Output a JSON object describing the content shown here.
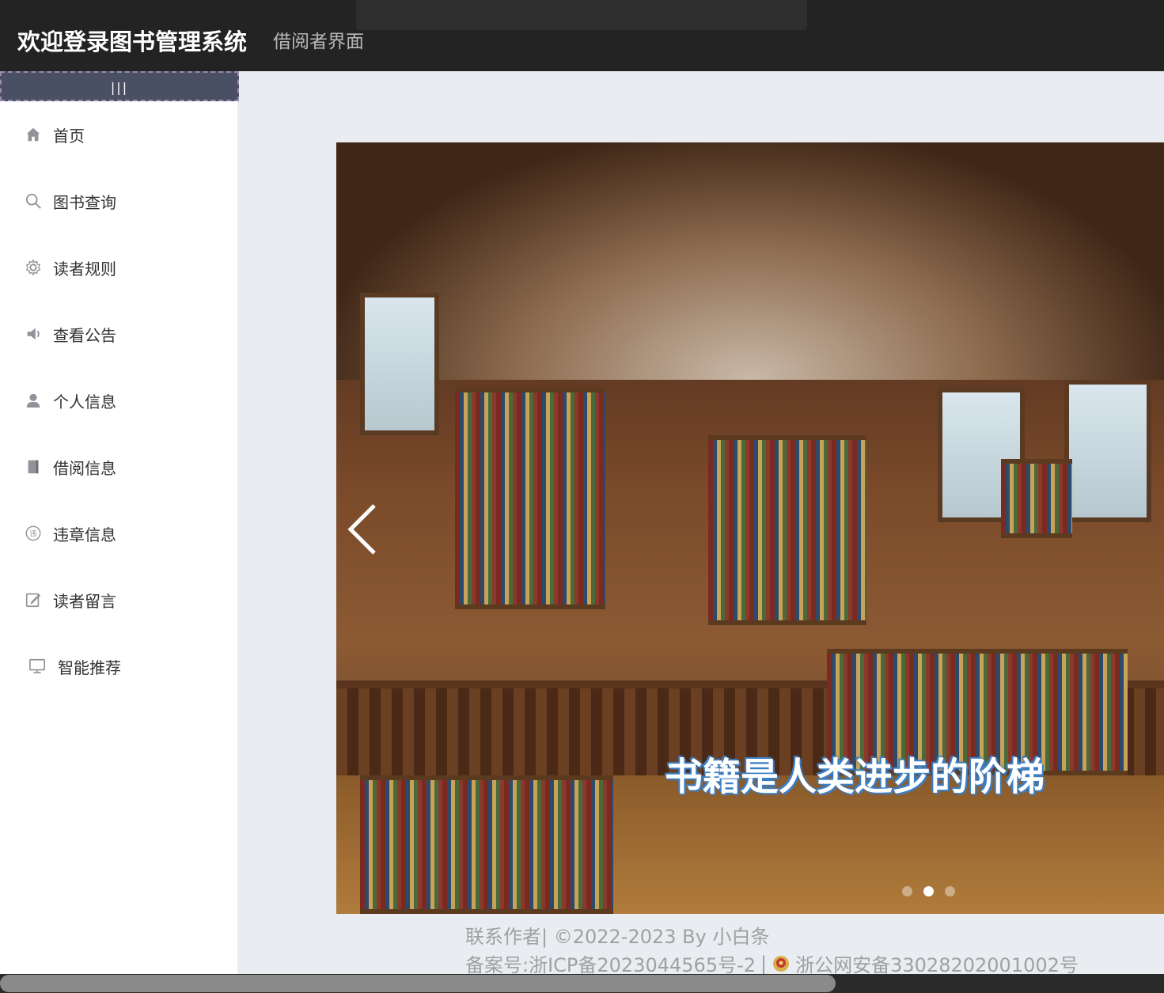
{
  "header": {
    "title": "欢迎登录图书管理系统",
    "subtitle": "借阅者界面"
  },
  "sidebar": {
    "collapse_label": "|||",
    "items": [
      {
        "icon": "home-icon",
        "label": "首页"
      },
      {
        "icon": "search-icon",
        "label": "图书查询"
      },
      {
        "icon": "settings-icon",
        "label": "读者规则"
      },
      {
        "icon": "speaker-icon",
        "label": "查看公告"
      },
      {
        "icon": "user-icon",
        "label": "个人信息"
      },
      {
        "icon": "book-icon",
        "label": "借阅信息"
      },
      {
        "icon": "violation-icon",
        "label": "违章信息"
      },
      {
        "icon": "edit-icon",
        "label": "读者留言"
      },
      {
        "icon": "monitor-icon",
        "label": "智能推荐"
      }
    ],
    "violation_icon_char": "违"
  },
  "carousel": {
    "caption": "书籍是人类进步的阶梯",
    "slide_count": 3,
    "active_index": 1
  },
  "footer": {
    "line1": "联系作者| ©2022-2023 By 小白条",
    "icp": "备案号:浙ICP备2023044565号-2",
    "separator": "|",
    "police": "浙公网安备33028202001002号"
  },
  "colors": {
    "header_bg": "#232323",
    "sidebar_toggle_bg": "#4a5064",
    "content_bg": "#e9ecf1",
    "caption_outline": "#3c7fc4"
  }
}
